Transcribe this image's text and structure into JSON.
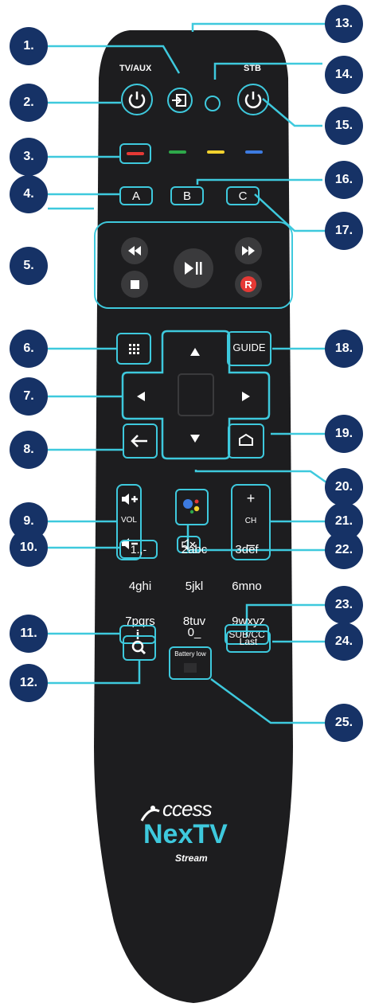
{
  "callouts": [
    "1.",
    "2.",
    "3.",
    "4.",
    "5.",
    "6.",
    "7.",
    "8.",
    "9.",
    "10.",
    "11.",
    "12.",
    "13.",
    "14.",
    "15.",
    "16.",
    "17.",
    "18.",
    "19.",
    "20.",
    "21.",
    "22.",
    "23.",
    "24.",
    "25."
  ],
  "top_labels": {
    "tv_aux": "TV/AUX",
    "stb": "STB"
  },
  "letters": {
    "a": "A",
    "b": "B",
    "c": "C"
  },
  "playback": {
    "record": "R"
  },
  "side": {
    "guide": "GUIDE",
    "vol": "VOL",
    "ch": "CH",
    "plus": "+",
    "minus": "–"
  },
  "keypad": {
    "k1": "1.,-",
    "k2": "2abc",
    "k3": "3def",
    "k4": "4ghi",
    "k5": "5jkl",
    "k6": "6mno",
    "k7": "7pqrs",
    "k8": "8tuv",
    "k9": "9wxyz",
    "info": "i",
    "k0": "0_",
    "subcc": "SUB/CC"
  },
  "bottom": {
    "battery": "Battery low",
    "last": "Last"
  },
  "brand": {
    "line1": "ccess",
    "line2": "NexTV",
    "line3": "Stream"
  },
  "colors": {
    "callout": "#163266",
    "accent": "#3ec9dd",
    "remote": "#1d1d1f",
    "red": "#e53935",
    "green": "#2ea84a",
    "yellow": "#f2d22e",
    "blue": "#3d7be0"
  },
  "icons": [
    "input-icon",
    "power-icon",
    "rewind-icon",
    "fast-forward-icon",
    "play-pause-icon",
    "stop-icon",
    "menu-grid-icon",
    "arrow-up-icon",
    "arrow-down-icon",
    "arrow-left-icon",
    "arrow-right-icon",
    "back-arrow-icon",
    "home-icon",
    "google-assistant-icon",
    "mute-icon",
    "search-icon",
    "volume-up-icon",
    "volume-down-icon"
  ]
}
